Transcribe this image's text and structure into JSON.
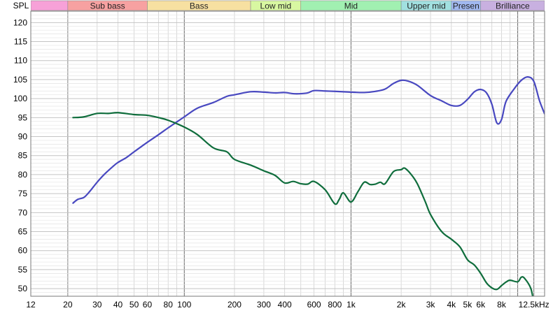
{
  "chart_data": {
    "type": "line",
    "ylabel": "SPL",
    "x_scale": "log",
    "xlim": [
      12,
      14500
    ],
    "ylim": [
      48,
      123
    ],
    "grid": true,
    "x_ticks": [
      {
        "v": 12,
        "label": "12"
      },
      {
        "v": 20,
        "label": "20"
      },
      {
        "v": 30,
        "label": "30"
      },
      {
        "v": 40,
        "label": "40"
      },
      {
        "v": 50,
        "label": "50"
      },
      {
        "v": 60,
        "label": "60"
      },
      {
        "v": 80,
        "label": "80"
      },
      {
        "v": 100,
        "label": "100"
      },
      {
        "v": 200,
        "label": "200"
      },
      {
        "v": 300,
        "label": "300"
      },
      {
        "v": 400,
        "label": "400"
      },
      {
        "v": 600,
        "label": "600"
      },
      {
        "v": 800,
        "label": "800"
      },
      {
        "v": 1000,
        "label": "1k"
      },
      {
        "v": 2000,
        "label": "2k"
      },
      {
        "v": 3000,
        "label": "3k"
      },
      {
        "v": 4000,
        "label": "4k"
      },
      {
        "v": 5000,
        "label": "5k"
      },
      {
        "v": 6000,
        "label": "6k"
      },
      {
        "v": 8000,
        "label": "8k"
      },
      {
        "v": 12500,
        "label": "12.5kHz"
      }
    ],
    "y_ticks": [
      50,
      55,
      60,
      65,
      70,
      75,
      80,
      85,
      90,
      95,
      100,
      105,
      110,
      115,
      120
    ],
    "bands": [
      {
        "label": "",
        "from": 12,
        "to": 20,
        "color": "#f7a1d8"
      },
      {
        "label": "Sub bass",
        "from": 20,
        "to": 60,
        "color": "#f7a1a1"
      },
      {
        "label": "Bass",
        "from": 60,
        "to": 250,
        "color": "#f7e0a1"
      },
      {
        "label": "Low mid",
        "from": 250,
        "to": 500,
        "color": "#d8f7a1"
      },
      {
        "label": "Mid",
        "from": 500,
        "to": 2000,
        "color": "#a1f0b1"
      },
      {
        "label": "Upper mid",
        "from": 2000,
        "to": 4000,
        "color": "#a1e0e0"
      },
      {
        "label": "Presen",
        "from": 4000,
        "to": 6000,
        "color": "#a1b8f0"
      },
      {
        "label": "Brilliance",
        "from": 6000,
        "to": 14500,
        "color": "#c8b0e0"
      }
    ],
    "series": [
      {
        "color": "#4848c0",
        "points": [
          [
            21.5,
            72.5
          ],
          [
            23,
            73.5
          ],
          [
            25,
            74
          ],
          [
            27,
            75.5
          ],
          [
            30,
            78
          ],
          [
            33,
            80
          ],
          [
            37,
            82
          ],
          [
            40,
            83.2
          ],
          [
            45,
            84.5
          ],
          [
            50,
            86
          ],
          [
            60,
            88.5
          ],
          [
            70,
            90.5
          ],
          [
            80,
            92.3
          ],
          [
            100,
            95.2
          ],
          [
            120,
            97.5
          ],
          [
            150,
            99
          ],
          [
            180,
            100.6
          ],
          [
            200,
            101
          ],
          [
            250,
            101.8
          ],
          [
            300,
            101.7
          ],
          [
            350,
            101.5
          ],
          [
            400,
            101.6
          ],
          [
            450,
            101.3
          ],
          [
            500,
            101.3
          ],
          [
            550,
            101.5
          ],
          [
            600,
            102.1
          ],
          [
            700,
            102
          ],
          [
            800,
            101.9
          ],
          [
            1000,
            101.7
          ],
          [
            1200,
            101.6
          ],
          [
            1400,
            101.9
          ],
          [
            1600,
            102.5
          ],
          [
            1800,
            104
          ],
          [
            2000,
            104.8
          ],
          [
            2200,
            104.6
          ],
          [
            2500,
            103.5
          ],
          [
            3000,
            100.8
          ],
          [
            3500,
            99.4
          ],
          [
            4000,
            98.2
          ],
          [
            4500,
            98.2
          ],
          [
            5000,
            99.8
          ],
          [
            5500,
            101.8
          ],
          [
            6000,
            102.4
          ],
          [
            6500,
            101.5
          ],
          [
            7000,
            98.5
          ],
          [
            7500,
            93.6
          ],
          [
            8000,
            94.5
          ],
          [
            8500,
            99.2
          ],
          [
            9500,
            102.5
          ],
          [
            10500,
            104.8
          ],
          [
            11500,
            105.7
          ],
          [
            12500,
            104.5
          ],
          [
            13500,
            99.5
          ],
          [
            14500,
            96
          ]
        ]
      },
      {
        "color": "#0f6d3c",
        "points": [
          [
            21.5,
            95
          ],
          [
            25,
            95.2
          ],
          [
            30,
            96.1
          ],
          [
            35,
            96.1
          ],
          [
            40,
            96.3
          ],
          [
            50,
            95.8
          ],
          [
            60,
            95.6
          ],
          [
            70,
            95
          ],
          [
            80,
            94.3
          ],
          [
            100,
            92.5
          ],
          [
            120,
            90.5
          ],
          [
            150,
            87
          ],
          [
            180,
            86
          ],
          [
            200,
            84
          ],
          [
            250,
            82.5
          ],
          [
            300,
            81
          ],
          [
            350,
            79.8
          ],
          [
            400,
            77.8
          ],
          [
            450,
            78.2
          ],
          [
            500,
            77.6
          ],
          [
            550,
            77.5
          ],
          [
            600,
            78.2
          ],
          [
            700,
            76
          ],
          [
            800,
            72.3
          ],
          [
            850,
            73.5
          ],
          [
            900,
            75.2
          ],
          [
            1000,
            72.8
          ],
          [
            1100,
            75.5
          ],
          [
            1200,
            78
          ],
          [
            1300,
            77.4
          ],
          [
            1400,
            77.5
          ],
          [
            1500,
            78
          ],
          [
            1600,
            77.6
          ],
          [
            1800,
            80.8
          ],
          [
            2000,
            81.3
          ],
          [
            2100,
            81.7
          ],
          [
            2300,
            80
          ],
          [
            2500,
            77.6
          ],
          [
            2800,
            72.7
          ],
          [
            3000,
            69.5
          ],
          [
            3500,
            65
          ],
          [
            4000,
            63
          ],
          [
            4500,
            61
          ],
          [
            5000,
            57.6
          ],
          [
            5500,
            56.2
          ],
          [
            6000,
            54
          ],
          [
            6500,
            51.5
          ],
          [
            7000,
            50.2
          ],
          [
            7500,
            49.8
          ],
          [
            8000,
            50.8
          ],
          [
            8500,
            51.7
          ],
          [
            9000,
            52.2
          ],
          [
            10000,
            51.8
          ],
          [
            10500,
            53
          ],
          [
            11000,
            52.7
          ],
          [
            12000,
            50
          ],
          [
            12500,
            46
          ]
        ]
      }
    ]
  }
}
